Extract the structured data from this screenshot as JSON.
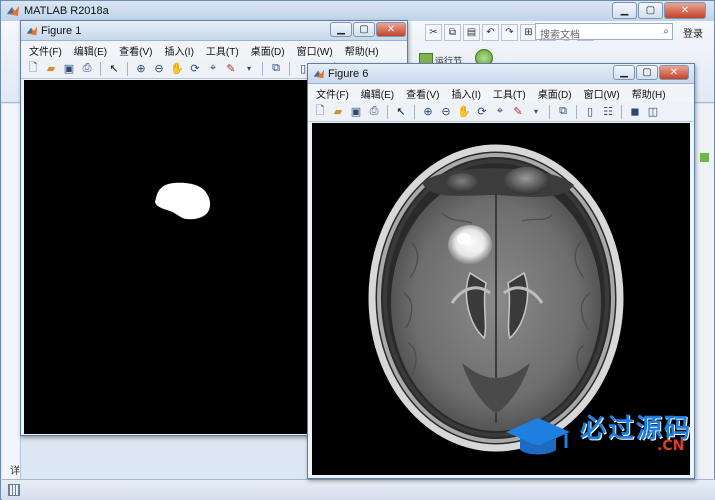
{
  "main": {
    "title": "MATLAB R2018a",
    "search_placeholder": "搜索文档",
    "login_label": "登录",
    "run_section_label": "运行节",
    "left_panel_text": "详"
  },
  "figure1": {
    "title": "Figure 1",
    "menu": [
      "文件(F)",
      "编辑(E)",
      "查看(V)",
      "插入(I)",
      "工具(T)",
      "桌面(D)",
      "窗口(W)",
      "帮助(H)"
    ]
  },
  "figure6": {
    "title": "Figure 6",
    "menu": [
      "文件(F)",
      "编辑(E)",
      "查看(V)",
      "插入(I)",
      "工具(T)",
      "桌面(D)",
      "窗口(W)",
      "帮助(H)"
    ]
  },
  "watermark": {
    "text": "必过源码",
    "suffix": ".CN"
  },
  "colors": {
    "accent": "#1f7fe0",
    "watermark_red": "#e03a1f",
    "canvas": "#000000"
  }
}
